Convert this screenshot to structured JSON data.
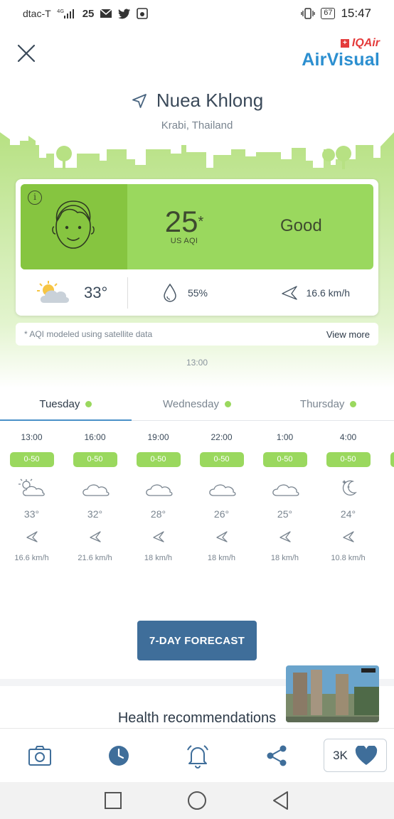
{
  "status_bar": {
    "carrier": "dtac-T",
    "network": "4G",
    "number": "25",
    "battery": "67",
    "time": "15:47"
  },
  "header": {
    "brand_top": "IQAir",
    "brand_bottom": "AirVisual",
    "city": "Nuea Khlong",
    "region": "Krabi, Thailand"
  },
  "aqi": {
    "value": "25",
    "asterisk": "*",
    "unit": "US AQI",
    "status": "Good",
    "color": "#9ad85e",
    "face_color": "#86c540"
  },
  "weather": {
    "temperature": "33°",
    "humidity": "55%",
    "wind": "16.6 km/h"
  },
  "note": {
    "text": "* AQI modeled using satellite data",
    "link": "View more"
  },
  "updated_time": "13:00",
  "tabs": [
    {
      "label": "Tuesday",
      "active": true
    },
    {
      "label": "Wednesday",
      "active": false
    },
    {
      "label": "Thursday",
      "active": false
    }
  ],
  "hourly": [
    {
      "time": "13:00",
      "aqi": "0-50",
      "icon": "partly-cloudy-sun-icon",
      "temp": "33°",
      "wind": "16.6 km/h"
    },
    {
      "time": "16:00",
      "aqi": "0-50",
      "icon": "cloud-icon",
      "temp": "32°",
      "wind": "21.6 km/h"
    },
    {
      "time": "19:00",
      "aqi": "0-50",
      "icon": "cloud-icon",
      "temp": "28°",
      "wind": "18 km/h"
    },
    {
      "time": "22:00",
      "aqi": "0-50",
      "icon": "cloud-icon",
      "temp": "26°",
      "wind": "18 km/h"
    },
    {
      "time": "1:00",
      "aqi": "0-50",
      "icon": "cloud-icon",
      "temp": "25°",
      "wind": "18 km/h"
    },
    {
      "time": "4:00",
      "aqi": "0-50",
      "icon": "moon-stars-icon",
      "temp": "24°",
      "wind": "10.8 km/h"
    }
  ],
  "forecast_button": "7-DAY FORECAST",
  "health_title": "Health recommendations",
  "bottom_bar": {
    "likes": "3K"
  }
}
